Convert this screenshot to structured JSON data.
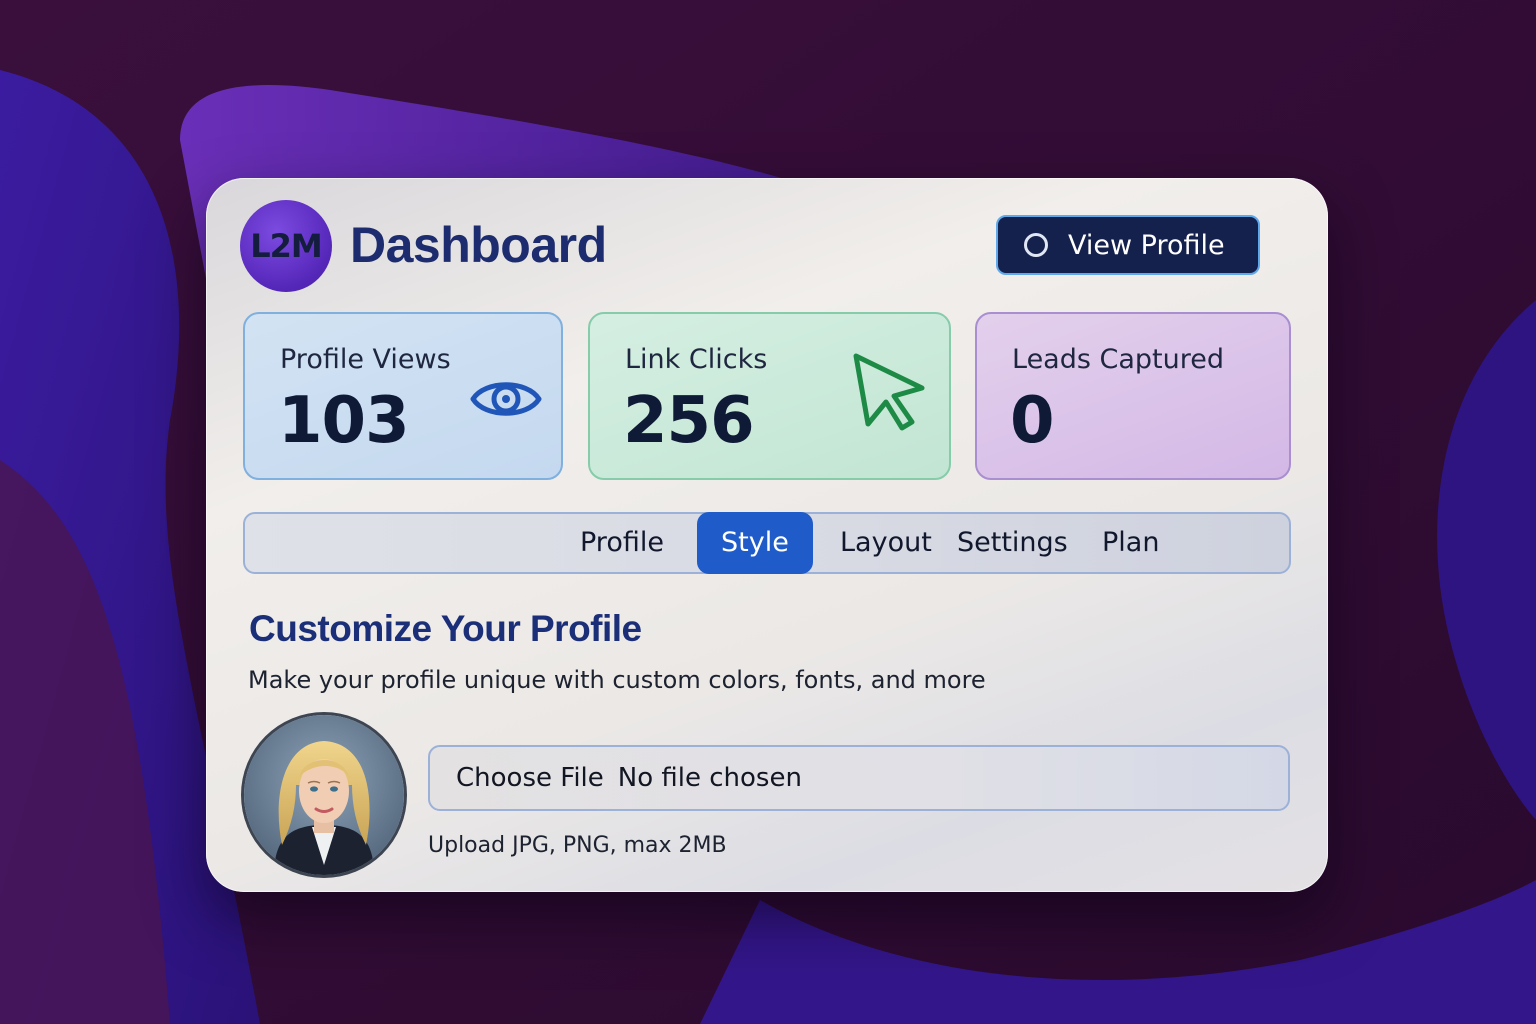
{
  "app": {
    "logo_text": "L2M",
    "title": "Dashboard",
    "view_profile_label": "View Profile"
  },
  "stats": [
    {
      "label": "Profile Views",
      "value": "103",
      "icon": "eye-icon",
      "color": "#1f56b8"
    },
    {
      "label": "Link Clicks",
      "value": "256",
      "icon": "cursor-arrow-icon",
      "color": "#1d8a45"
    },
    {
      "label": "Leads Captured",
      "value": "0"
    }
  ],
  "tabs": [
    {
      "label": "Profile",
      "active": false
    },
    {
      "label": "Style",
      "active": true
    },
    {
      "label": "Layout",
      "active": false
    },
    {
      "label": "Settings",
      "active": false
    },
    {
      "label": "Plan",
      "active": false
    }
  ],
  "section": {
    "title": "Customize Your Profile",
    "subtitle": "Make your profile unique with custom colors, fonts, and more"
  },
  "upload": {
    "button_label": "Choose File",
    "status": "No file chosen",
    "hint": "Upload JPG, PNG, max 2MB"
  },
  "colors": {
    "accent": "#1f5cc9",
    "title": "#1c2c6e",
    "button_bg": "#15214d"
  }
}
